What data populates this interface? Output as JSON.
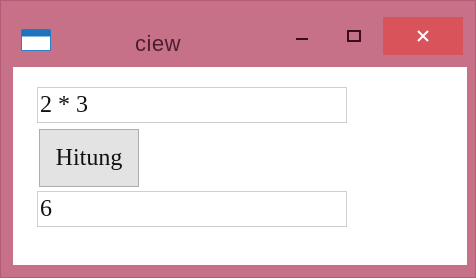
{
  "window": {
    "title": "ciew",
    "controls": {
      "minimize": "minimize-icon",
      "maximize": "maximize-icon",
      "close": "close-icon"
    },
    "colors": {
      "frame": "#c77189",
      "close_button": "#d9535a"
    }
  },
  "form": {
    "expression_value": "2 * 3",
    "calculate_label": "Hitung",
    "result_value": "6"
  }
}
